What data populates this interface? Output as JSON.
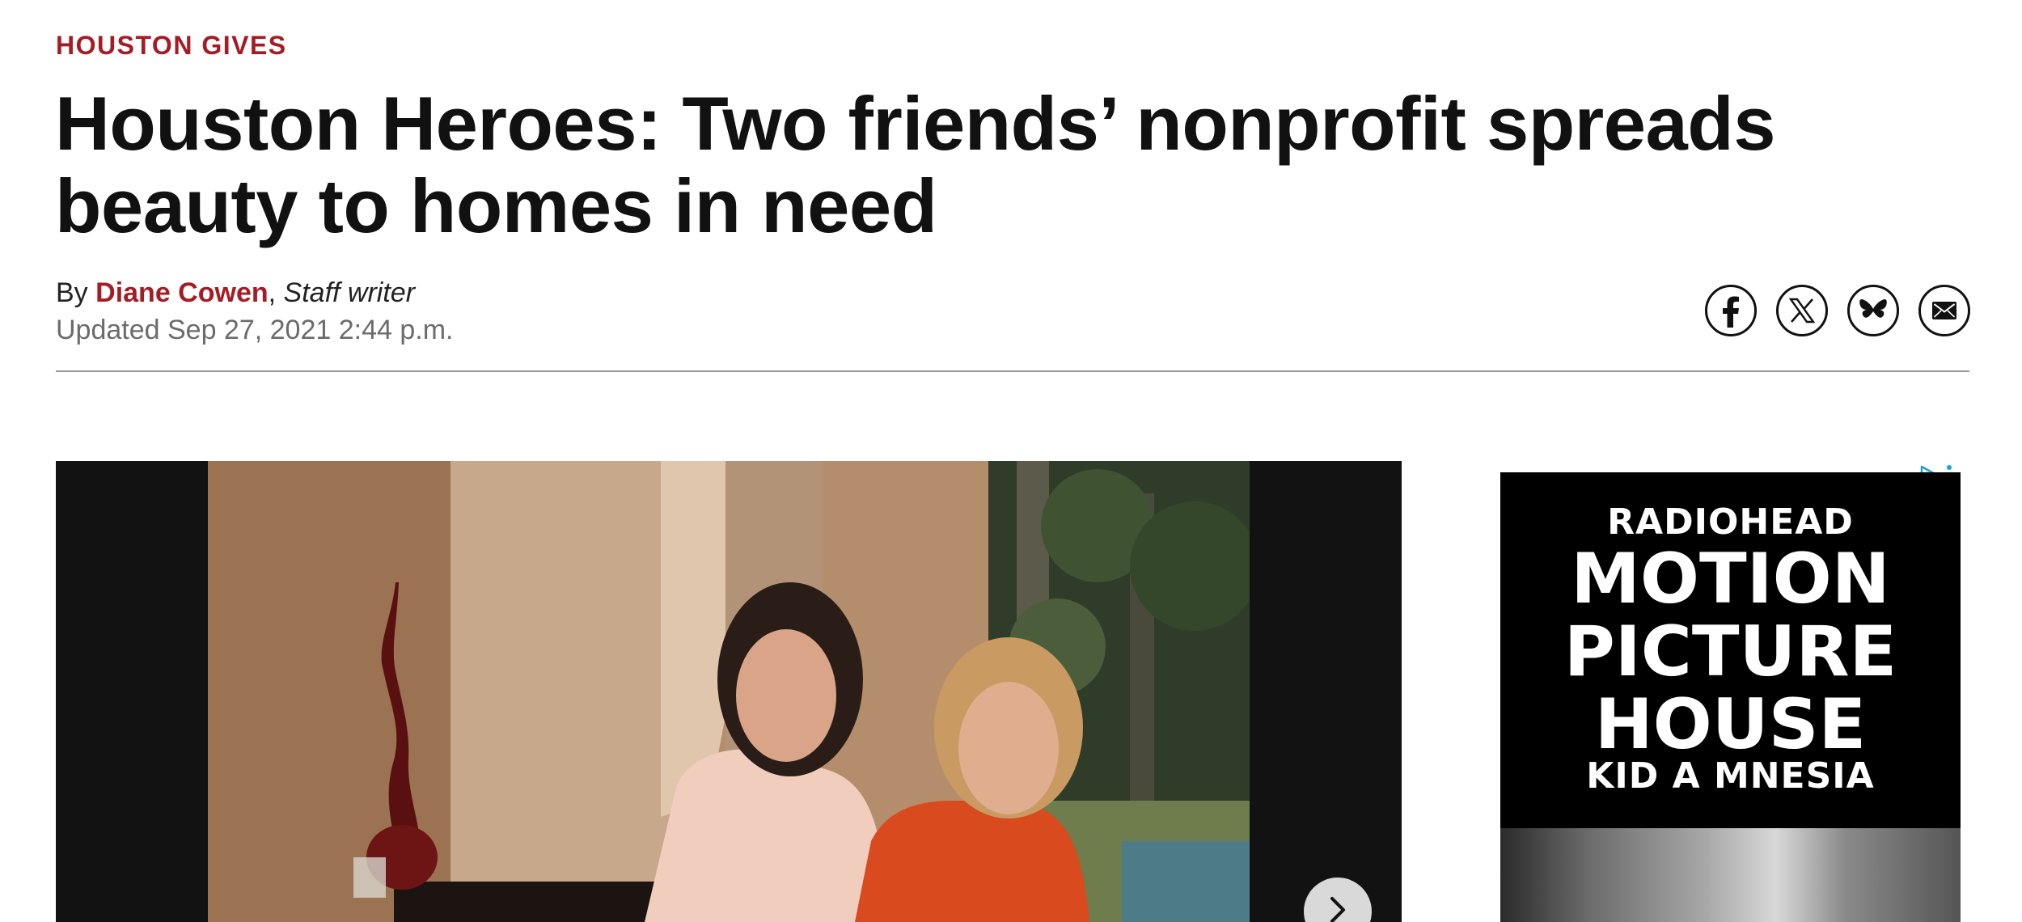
{
  "article": {
    "kicker": "HOUSTON GIVES",
    "headline": "Houston Heroes: Two friends’ nonprofit spreads beauty to homes in need",
    "byline_prefix": "By",
    "author": "Diane Cowen",
    "author_separator": ",",
    "author_role": "Staff writer",
    "updated": "Updated Sep 27, 2021 2:44 p.m."
  },
  "share": {
    "icons": [
      "facebook-icon",
      "x-icon",
      "bluesky-icon",
      "email-icon"
    ]
  },
  "media": {
    "photo_next_icon": "chevron-right-icon"
  },
  "ad": {
    "line1": "RADIOHEAD",
    "line2": "MOTION",
    "line3": "PICTURE",
    "line4": "HOUSE",
    "line5": "KID A MNESIA",
    "choices_icon": "adchoices-icon",
    "menu_icon": "more-vertical-icon"
  },
  "colors": {
    "accent": "#a51c24",
    "text": "#111111",
    "muted": "#6b6b6b",
    "media_bg": "#121212"
  }
}
